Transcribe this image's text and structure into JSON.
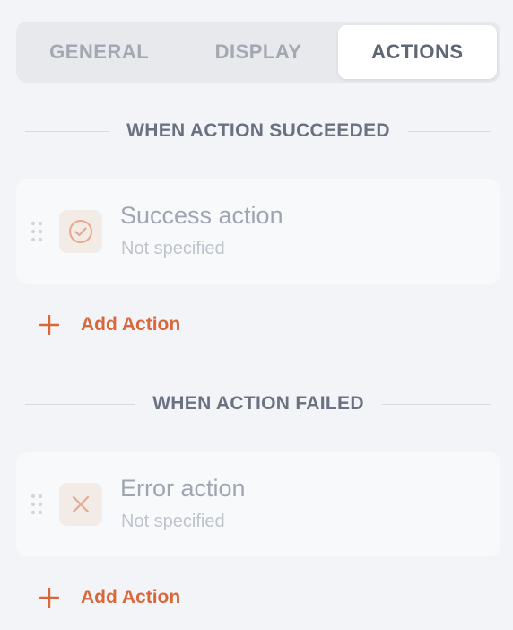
{
  "tabs": [
    {
      "label": "GENERAL",
      "active": false
    },
    {
      "label": "DISPLAY",
      "active": false
    },
    {
      "label": "ACTIONS",
      "active": true
    }
  ],
  "sections": {
    "succeeded": {
      "title": "WHEN ACTION SUCCEEDED",
      "action": {
        "title": "Success action",
        "subtitle": "Not specified",
        "icon": "check-circle-icon"
      },
      "add_label": "Add Action"
    },
    "failed": {
      "title": "WHEN ACTION FAILED",
      "action": {
        "title": "Error action",
        "subtitle": "Not specified",
        "icon": "x-icon"
      },
      "add_label": "Add Action"
    }
  },
  "colors": {
    "accent": "#d9673a",
    "icon_tint": "#e8a98e",
    "background": "#f3f4f7"
  }
}
